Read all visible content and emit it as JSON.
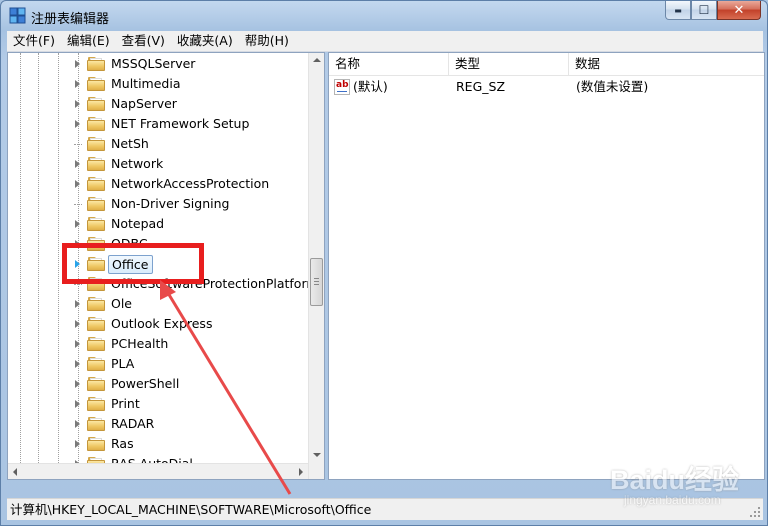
{
  "window": {
    "title": "注册表编辑器"
  },
  "caption": {
    "minimize": "▬",
    "maximize": "☐",
    "close": "✕"
  },
  "menu": [
    "文件(F)",
    "编辑(E)",
    "查看(V)",
    "收藏夹(A)",
    "帮助(H)"
  ],
  "tree": {
    "items": [
      {
        "label": "MSSQLServer",
        "expandable": true
      },
      {
        "label": "Multimedia",
        "expandable": true
      },
      {
        "label": "NapServer",
        "expandable": true
      },
      {
        "label": "NET Framework Setup",
        "expandable": true
      },
      {
        "label": "NetSh",
        "expandable": false
      },
      {
        "label": "Network",
        "expandable": true
      },
      {
        "label": "NetworkAccessProtection",
        "expandable": true
      },
      {
        "label": "Non-Driver Signing",
        "expandable": false
      },
      {
        "label": "Notepad",
        "expandable": true
      },
      {
        "label": "ODBC",
        "expandable": true
      },
      {
        "label": "Office",
        "expandable": true,
        "selected": true
      },
      {
        "label": "OfficeSoftwareProtectionPlatform",
        "expandable": false
      },
      {
        "label": "Ole",
        "expandable": true
      },
      {
        "label": "Outlook Express",
        "expandable": true
      },
      {
        "label": "PCHealth",
        "expandable": true
      },
      {
        "label": "PLA",
        "expandable": true
      },
      {
        "label": "PowerShell",
        "expandable": true
      },
      {
        "label": "Print",
        "expandable": true
      },
      {
        "label": "RADAR",
        "expandable": true
      },
      {
        "label": "Ras",
        "expandable": true
      },
      {
        "label": "RAS AutoDial",
        "expandable": true
      }
    ]
  },
  "list": {
    "columns": [
      "名称",
      "类型",
      "数据"
    ],
    "rows": [
      {
        "name": "(默认)",
        "type": "REG_SZ",
        "data": "(数值未设置)",
        "icon": "string-value-icon"
      }
    ]
  },
  "status": {
    "path": "计算机\\HKEY_LOCAL_MACHINE\\SOFTWARE\\Microsoft\\Office"
  },
  "watermark": {
    "main": "Baidu经验",
    "sub": "jingyan.baidu.com"
  },
  "colors": {
    "annotation": "#e81e1e",
    "selection_border": "#7da2ce",
    "title_bar": "#a9c4e2"
  }
}
